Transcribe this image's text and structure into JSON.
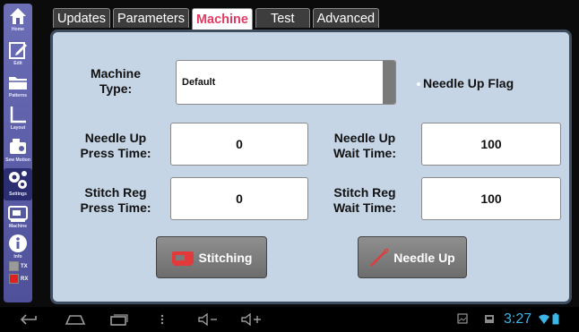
{
  "sidebar": {
    "items": [
      {
        "label": "Home",
        "icon": "home-icon"
      },
      {
        "label": "Edit",
        "icon": "edit-icon"
      },
      {
        "label": "Patterns",
        "icon": "folder-icon"
      },
      {
        "label": "Layout",
        "icon": "layout-icon"
      },
      {
        "label": "Sew Motion",
        "icon": "sew-motion-icon"
      },
      {
        "label": "Settings",
        "icon": "gears-icon"
      },
      {
        "label": "Machine",
        "icon": "machine-icon"
      },
      {
        "label": "Info",
        "icon": "info-icon"
      }
    ],
    "tx_label": "TX",
    "rx_label": "RX",
    "tx_color": "#9a9a9a",
    "rx_color": "#e02020"
  },
  "tabs": [
    {
      "label": "Updates"
    },
    {
      "label": "Parameters"
    },
    {
      "label": "Machine",
      "active": true
    },
    {
      "label": "Test"
    },
    {
      "label": "Advanced"
    }
  ],
  "form": {
    "machine_type_label": "Machine Type:",
    "machine_type_value": "Default",
    "needle_up_flag_label": "Needle Up Flag",
    "needle_up_press_label": "Needle Up Press Time:",
    "needle_up_press_value": "0",
    "needle_up_wait_label": "Needle Up Wait Time:",
    "needle_up_wait_value": "100",
    "stitch_reg_press_label": "Stitch Reg Press Time:",
    "stitch_reg_press_value": "0",
    "stitch_reg_wait_label": "Stitch Reg Wait Time:",
    "stitch_reg_wait_value": "100"
  },
  "buttons": {
    "stitching_label": "Stitching",
    "needle_up_label": "Needle Up"
  },
  "navbar": {
    "clock": "3:27"
  },
  "colors": {
    "accent": "#e23a63",
    "panel": "#c5d5e6",
    "sidebar": "#5c5fa8",
    "clock": "#3ab6e8"
  }
}
